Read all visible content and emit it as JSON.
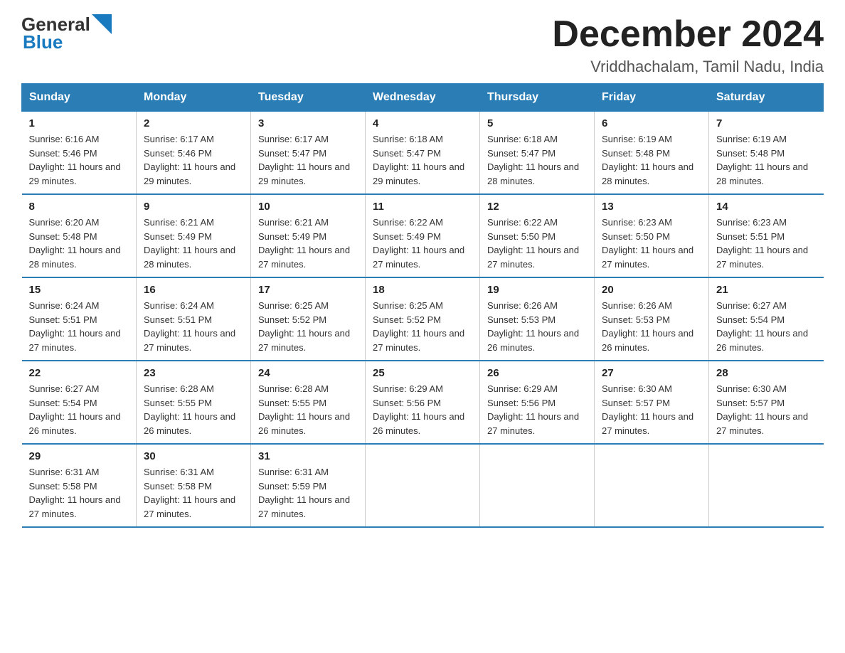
{
  "header": {
    "logo_general": "General",
    "logo_blue": "Blue",
    "title": "December 2024",
    "subtitle": "Vriddhachalam, Tamil Nadu, India"
  },
  "weekdays": [
    "Sunday",
    "Monday",
    "Tuesday",
    "Wednesday",
    "Thursday",
    "Friday",
    "Saturday"
  ],
  "weeks": [
    [
      {
        "day": "1",
        "sunrise": "6:16 AM",
        "sunset": "5:46 PM",
        "daylight": "11 hours and 29 minutes."
      },
      {
        "day": "2",
        "sunrise": "6:17 AM",
        "sunset": "5:46 PM",
        "daylight": "11 hours and 29 minutes."
      },
      {
        "day": "3",
        "sunrise": "6:17 AM",
        "sunset": "5:47 PM",
        "daylight": "11 hours and 29 minutes."
      },
      {
        "day": "4",
        "sunrise": "6:18 AM",
        "sunset": "5:47 PM",
        "daylight": "11 hours and 29 minutes."
      },
      {
        "day": "5",
        "sunrise": "6:18 AM",
        "sunset": "5:47 PM",
        "daylight": "11 hours and 28 minutes."
      },
      {
        "day": "6",
        "sunrise": "6:19 AM",
        "sunset": "5:48 PM",
        "daylight": "11 hours and 28 minutes."
      },
      {
        "day": "7",
        "sunrise": "6:19 AM",
        "sunset": "5:48 PM",
        "daylight": "11 hours and 28 minutes."
      }
    ],
    [
      {
        "day": "8",
        "sunrise": "6:20 AM",
        "sunset": "5:48 PM",
        "daylight": "11 hours and 28 minutes."
      },
      {
        "day": "9",
        "sunrise": "6:21 AM",
        "sunset": "5:49 PM",
        "daylight": "11 hours and 28 minutes."
      },
      {
        "day": "10",
        "sunrise": "6:21 AM",
        "sunset": "5:49 PM",
        "daylight": "11 hours and 27 minutes."
      },
      {
        "day": "11",
        "sunrise": "6:22 AM",
        "sunset": "5:49 PM",
        "daylight": "11 hours and 27 minutes."
      },
      {
        "day": "12",
        "sunrise": "6:22 AM",
        "sunset": "5:50 PM",
        "daylight": "11 hours and 27 minutes."
      },
      {
        "day": "13",
        "sunrise": "6:23 AM",
        "sunset": "5:50 PM",
        "daylight": "11 hours and 27 minutes."
      },
      {
        "day": "14",
        "sunrise": "6:23 AM",
        "sunset": "5:51 PM",
        "daylight": "11 hours and 27 minutes."
      }
    ],
    [
      {
        "day": "15",
        "sunrise": "6:24 AM",
        "sunset": "5:51 PM",
        "daylight": "11 hours and 27 minutes."
      },
      {
        "day": "16",
        "sunrise": "6:24 AM",
        "sunset": "5:51 PM",
        "daylight": "11 hours and 27 minutes."
      },
      {
        "day": "17",
        "sunrise": "6:25 AM",
        "sunset": "5:52 PM",
        "daylight": "11 hours and 27 minutes."
      },
      {
        "day": "18",
        "sunrise": "6:25 AM",
        "sunset": "5:52 PM",
        "daylight": "11 hours and 27 minutes."
      },
      {
        "day": "19",
        "sunrise": "6:26 AM",
        "sunset": "5:53 PM",
        "daylight": "11 hours and 26 minutes."
      },
      {
        "day": "20",
        "sunrise": "6:26 AM",
        "sunset": "5:53 PM",
        "daylight": "11 hours and 26 minutes."
      },
      {
        "day": "21",
        "sunrise": "6:27 AM",
        "sunset": "5:54 PM",
        "daylight": "11 hours and 26 minutes."
      }
    ],
    [
      {
        "day": "22",
        "sunrise": "6:27 AM",
        "sunset": "5:54 PM",
        "daylight": "11 hours and 26 minutes."
      },
      {
        "day": "23",
        "sunrise": "6:28 AM",
        "sunset": "5:55 PM",
        "daylight": "11 hours and 26 minutes."
      },
      {
        "day": "24",
        "sunrise": "6:28 AM",
        "sunset": "5:55 PM",
        "daylight": "11 hours and 26 minutes."
      },
      {
        "day": "25",
        "sunrise": "6:29 AM",
        "sunset": "5:56 PM",
        "daylight": "11 hours and 26 minutes."
      },
      {
        "day": "26",
        "sunrise": "6:29 AM",
        "sunset": "5:56 PM",
        "daylight": "11 hours and 27 minutes."
      },
      {
        "day": "27",
        "sunrise": "6:30 AM",
        "sunset": "5:57 PM",
        "daylight": "11 hours and 27 minutes."
      },
      {
        "day": "28",
        "sunrise": "6:30 AM",
        "sunset": "5:57 PM",
        "daylight": "11 hours and 27 minutes."
      }
    ],
    [
      {
        "day": "29",
        "sunrise": "6:31 AM",
        "sunset": "5:58 PM",
        "daylight": "11 hours and 27 minutes."
      },
      {
        "day": "30",
        "sunrise": "6:31 AM",
        "sunset": "5:58 PM",
        "daylight": "11 hours and 27 minutes."
      },
      {
        "day": "31",
        "sunrise": "6:31 AM",
        "sunset": "5:59 PM",
        "daylight": "11 hours and 27 minutes."
      },
      null,
      null,
      null,
      null
    ]
  ]
}
